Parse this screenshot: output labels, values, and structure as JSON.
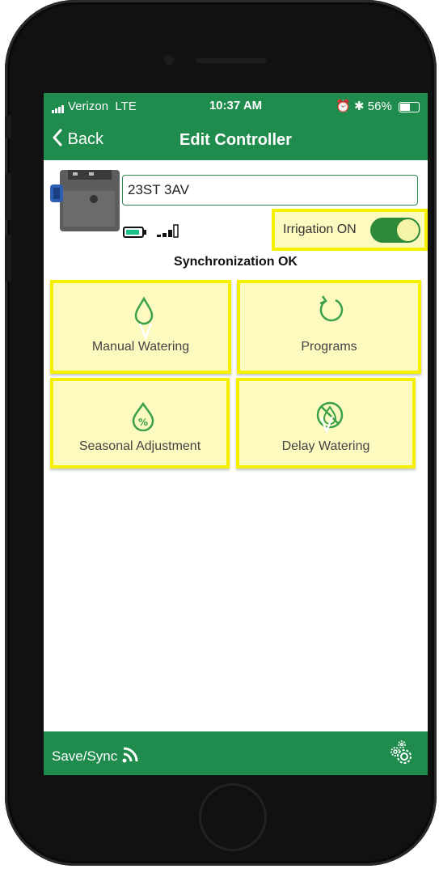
{
  "status_bar": {
    "carrier": "Verizon",
    "network": "LTE",
    "time": "10:37 AM",
    "battery_percent": "56%"
  },
  "nav": {
    "back_label": "Back",
    "title": "Edit Controller"
  },
  "controller": {
    "name": "23ST 3AV",
    "irrigation_label": "Irrigation ON",
    "irrigation_on": true,
    "sync_status": "Synchronization OK"
  },
  "tiles": {
    "manual_watering": "Manual Watering",
    "programs": "Programs",
    "seasonal_adjustment": "Seasonal Adjustment",
    "delay_watering": "Delay Watering"
  },
  "footer": {
    "save_label": "Save/Sync"
  },
  "colors": {
    "brand_green": "#1f8b4c",
    "highlight_yellow": "#f5f000",
    "tile_fill": "#fdfac0"
  },
  "icons": [
    "back-chevron-icon",
    "battery-icon",
    "signal-icon",
    "water-drop-icon",
    "refresh-icon",
    "percent-drop-icon",
    "no-drop-icon",
    "wifi-sync-icon",
    "gears-icon"
  ]
}
